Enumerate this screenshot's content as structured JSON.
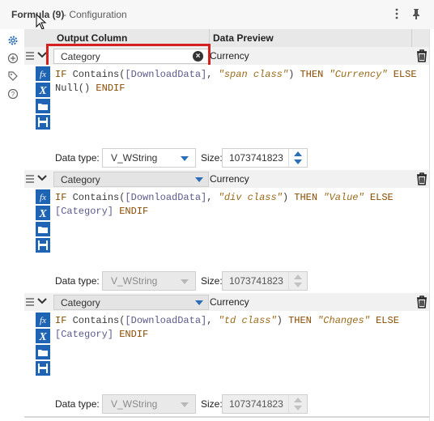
{
  "window": {
    "tool_name": "Formula (9)",
    "subtitle": "- Configuration"
  },
  "toolbar_icons": [
    "more-options-icon",
    "pin-icon"
  ],
  "sidebar_icons": [
    "gear-icon",
    "workflow-icon",
    "tag-icon",
    "help-icon"
  ],
  "columns": {
    "output": "Output Column",
    "preview": "Data Preview"
  },
  "formulas": [
    {
      "output_column": "Category",
      "preview": "Currency",
      "expression": [
        {
          "t": "kw",
          "v": "IF "
        },
        {
          "t": "fn",
          "v": "Contains("
        },
        {
          "t": "fld",
          "v": "[DownloadData]"
        },
        {
          "t": "fn",
          "v": ", "
        },
        {
          "t": "str",
          "v": "\"span class\""
        },
        {
          "t": "fn",
          "v": ") "
        },
        {
          "t": "kw",
          "v": "THEN "
        },
        {
          "t": "str",
          "v": "\"Currency\""
        },
        {
          "t": "kw",
          "v": " ELSE\n"
        },
        {
          "t": "fn",
          "v": "Null() "
        },
        {
          "t": "kw",
          "v": "ENDIF"
        }
      ],
      "data_type_label": "Data type:",
      "data_type": "V_WString",
      "size_label": "Size:",
      "size": "1073741823"
    },
    {
      "output_column": "Category",
      "preview": "Currency",
      "expression": [
        {
          "t": "kw",
          "v": "IF "
        },
        {
          "t": "fn",
          "v": "Contains("
        },
        {
          "t": "fld",
          "v": "[DownloadData]"
        },
        {
          "t": "fn",
          "v": ", "
        },
        {
          "t": "str",
          "v": "\"div class\""
        },
        {
          "t": "fn",
          "v": ") "
        },
        {
          "t": "kw",
          "v": "THEN "
        },
        {
          "t": "str",
          "v": "\"Value\""
        },
        {
          "t": "kw",
          "v": " ELSE\n"
        },
        {
          "t": "fld",
          "v": "[Category] "
        },
        {
          "t": "kw",
          "v": "ENDIF"
        }
      ],
      "data_type_label": "Data type:",
      "data_type": "V_WString",
      "size_label": "Size:",
      "size": "1073741823"
    },
    {
      "output_column": "Category",
      "preview": "Currency",
      "expression": [
        {
          "t": "kw",
          "v": "IF "
        },
        {
          "t": "fn",
          "v": "Contains("
        },
        {
          "t": "fld",
          "v": "[DownloadData]"
        },
        {
          "t": "fn",
          "v": ", "
        },
        {
          "t": "str",
          "v": "\"td class\""
        },
        {
          "t": "fn",
          "v": ") "
        },
        {
          "t": "kw",
          "v": "THEN "
        },
        {
          "t": "str",
          "v": "\"Changes\""
        },
        {
          "t": "kw",
          "v": " ELSE\n"
        },
        {
          "t": "fld",
          "v": "[Category] "
        },
        {
          "t": "kw",
          "v": "ENDIF"
        }
      ],
      "data_type_label": "Data type:",
      "data_type": "V_WString",
      "size_label": "Size:",
      "size": "1073741823"
    }
  ],
  "tool_icons": [
    "fx-function-icon",
    "variable-x-icon",
    "folder-open-icon",
    "save-icon"
  ],
  "colors": {
    "highlight": "#d61f1f",
    "accent": "#2a6fb8",
    "tool_icon": "#1e63b4"
  }
}
